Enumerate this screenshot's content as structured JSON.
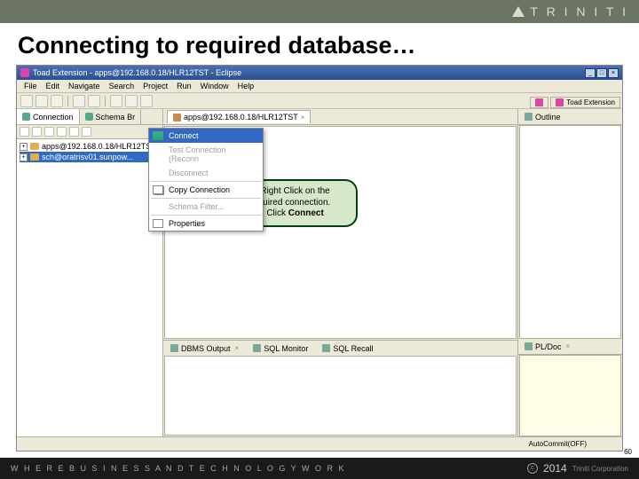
{
  "slide": {
    "title": "Connecting to required database…",
    "page_number": "60"
  },
  "brand": {
    "name": "T R I N I T I"
  },
  "window": {
    "title": "Toad Extension - apps@192.168.0.18/HLR12TST - Eclipse",
    "menus": [
      "File",
      "Edit",
      "Navigate",
      "Search",
      "Project",
      "Run",
      "Window",
      "Help"
    ]
  },
  "perspective": {
    "label": "Toad Extension"
  },
  "left": {
    "tabs": {
      "connection": "Connection",
      "schema": "Schema Br"
    },
    "items": [
      "apps@192.168.0.18/HLR12TST",
      "sch@oratrisv01.sunpow..."
    ]
  },
  "context": {
    "connect": "Connect",
    "test": "Test Connection (Reconn",
    "disconnect": "Disconnect",
    "copy": "Copy Connection",
    "filter": "Schema Filter...",
    "properties": "Properties"
  },
  "editor": {
    "tab": "apps@192.168.0.18/HLR12TST"
  },
  "bottom_tabs": {
    "dbms": "DBMS Output",
    "sqlmon": "SQL Monitor",
    "sqlrec": "SQL Recall"
  },
  "right": {
    "outline": "Outline",
    "pldoc": "PL/Doc"
  },
  "status": {
    "autocommit": "AutoCommit(OFF)"
  },
  "callout": {
    "line1": "1. Right Click on the",
    "line2": "required connection.",
    "line3a": "2. Click ",
    "line3b": "Connect"
  },
  "footer": {
    "tagline": "W H E R E   B U S I N E S S   A N D   T E C H N O L O G Y   W O R K",
    "year": "2014",
    "corp": "Triniti Corporation"
  }
}
